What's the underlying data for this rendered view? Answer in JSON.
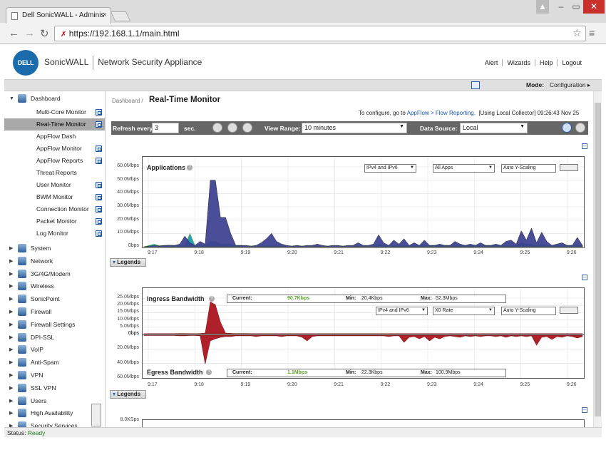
{
  "browser": {
    "tab_title": "Dell SonicWALL - Adminis",
    "url": "https://192.168.1.1/main.html"
  },
  "header": {
    "logo_text": "DELL",
    "product": "SonicWALL",
    "subtitle": "Network Security Appliance",
    "links": [
      "Alert",
      "Wizards",
      "Help",
      "Logout"
    ]
  },
  "modebar": {
    "label": "Mode:",
    "value": "Configuration"
  },
  "sidebar": {
    "dashboard_label": "Dashboard",
    "dashboard_items": [
      "Multi-Core Monitor",
      "Real-Time Monitor",
      "AppFlow Dash",
      "AppFlow Monitor",
      "AppFlow Reports",
      "Threat Reports",
      "User Monitor",
      "BWM Monitor",
      "Connection Monitor",
      "Packet Monitor",
      "Log Monitor"
    ],
    "dashboard_items_config": [
      true,
      true,
      false,
      true,
      true,
      false,
      true,
      true,
      true,
      true,
      true
    ],
    "selected_index": 1,
    "sections": [
      "System",
      "Network",
      "3G/4G/Modem",
      "Wireless",
      "SonicPoint",
      "Firewall",
      "Firewall Settings",
      "DPI-SSL",
      "VoIP",
      "Anti-Spam",
      "VPN",
      "SSL VPN",
      "Users",
      "High Availability",
      "Security Services"
    ]
  },
  "page": {
    "breadcrumb": "Dashboard /",
    "title": "Real-Time Monitor",
    "info_prefix": "To configure, go to",
    "info_link": "AppFlow > Flow Reporting.",
    "info_suffix": "[Using Local Collector] 09:26:43 Nov 25"
  },
  "toolbar": {
    "refresh_label": "Refresh every:",
    "refresh_value": "3",
    "refresh_unit": "sec.",
    "view_range_label": "View Range:",
    "view_range_value": "10 minutes",
    "data_source_label": "Data Source:",
    "data_source_value": "Local"
  },
  "chart_applications": {
    "type": "area",
    "title": "Applications",
    "y_ticks": [
      "60.0Mbps",
      "50.0Mbps",
      "40.0Mbps",
      "30.0Mbps",
      "20.0Mbps",
      "10.0Mbps",
      "0bps"
    ],
    "x_ticks": [
      "9:17",
      "9:18",
      "9:19",
      "9:20",
      "9:21",
      "9:22",
      "9:23",
      "9:24",
      "9:25",
      "9:26"
    ],
    "ip_filter": "IPv4 and IPv6",
    "app_filter": "All Apps",
    "scaling": "Auto Y-Scaling",
    "ylim_mbps": [
      0,
      60
    ],
    "series_main_mbps": [
      0,
      0.5,
      0.8,
      0.6,
      1,
      1.2,
      1,
      2,
      8,
      3,
      1,
      4,
      2,
      50,
      50,
      22,
      22,
      10,
      1,
      1,
      1,
      0.5,
      1,
      3,
      6,
      10,
      4,
      2,
      1,
      0.5,
      1,
      0.5,
      1,
      1,
      2,
      1,
      0.5,
      1,
      1,
      0.5,
      1,
      1,
      3,
      1,
      1,
      2,
      9,
      3,
      1,
      5,
      2,
      6,
      1,
      3,
      1,
      5,
      1,
      1,
      2,
      1,
      1,
      4,
      2,
      1,
      2,
      1,
      3,
      1,
      1,
      2,
      1,
      4,
      5,
      2,
      12,
      5,
      14,
      3,
      11,
      4,
      1,
      2,
      3,
      1,
      1,
      7,
      1
    ],
    "series_other_mbps": [
      0,
      1,
      2,
      0.8,
      1,
      0.6,
      1,
      1,
      1,
      10,
      1,
      1,
      1,
      4,
      4,
      2,
      2,
      2,
      1,
      1,
      0.5,
      0.5,
      0.5,
      0.5,
      1,
      1,
      1,
      0.5,
      0.5,
      0.5,
      0.5,
      0.5,
      0.5,
      0.5,
      0.5,
      0.5,
      0.5,
      0.5,
      0.5,
      0.5,
      0.5,
      0.5,
      0.5,
      0.5,
      0.5,
      0.5,
      2,
      1,
      1,
      1,
      1,
      1,
      1,
      1,
      1,
      1,
      1,
      1,
      1,
      1,
      1,
      1,
      1,
      1,
      1,
      1,
      1,
      1,
      1,
      1,
      1,
      1,
      1,
      1,
      3,
      2,
      2,
      1,
      2,
      1,
      1,
      1,
      1,
      1,
      1,
      1,
      1
    ]
  },
  "chart_bandwidth": {
    "type": "area",
    "ingress_title": "Ingress Bandwidth",
    "egress_title": "Egress Bandwidth",
    "ingress_y_ticks": [
      "25.0Mbps",
      "20.0Mbps",
      "15.0Mbps",
      "10.0Mbps",
      "5.0Mbps",
      "0bps"
    ],
    "egress_y_ticks": [
      "0bps",
      "20.0Mbps",
      "40.0Mbps",
      "60.0Mbps"
    ],
    "x_ticks": [
      "9:17",
      "9:18",
      "9:19",
      "9:20",
      "9:21",
      "9:22",
      "9:23",
      "9:24",
      "9:25",
      "9:26"
    ],
    "ingress_stats": {
      "current_label": "Current:",
      "current": "90.7Kbps",
      "min_label": "Min:",
      "min": "20.4Kbps",
      "max_label": "Max:",
      "max": "52.3Mbps"
    },
    "egress_stats": {
      "current_label": "Current:",
      "current": "1.1Mbps",
      "min_label": "Min:",
      "min": "22.3Kbps",
      "max_label": "Max:",
      "max": "100.9Mbps"
    },
    "ip_filter": "IPv4 and IPv6",
    "rate_filter": "X0 Rate",
    "scaling": "Auto Y-Scaling",
    "ingress_ylim_mbps": [
      0,
      25
    ],
    "egress_ylim_mbps": [
      0,
      60
    ],
    "ingress_mbps": [
      0,
      0.1,
      0.1,
      0.1,
      0.1,
      0.1,
      0.1,
      0.2,
      0.2,
      0.1,
      0.1,
      0.2,
      0.5,
      22,
      20,
      8,
      0.5,
      0.3,
      0.2,
      0.2,
      0.2,
      0.1,
      0.1,
      0.1,
      0.1,
      0.1,
      0.1,
      0.1,
      0.1,
      0.1,
      0.1,
      0.1,
      0.1,
      0.1,
      0.1,
      0.1,
      0.1,
      0.1,
      0.1,
      0.1,
      0.1,
      0.1,
      0.1,
      0.1,
      0.1,
      0.1,
      0.1,
      0.1,
      0.1,
      0.1,
      0.1,
      0.1,
      0.1,
      0.1,
      0.1,
      0.1,
      0.1,
      0.1,
      0.1,
      0.1,
      0.1,
      0.1,
      0.1,
      0.1,
      0.1,
      0.1,
      0.1,
      0.1,
      0.1,
      0.1,
      0.1,
      0.1,
      0.1,
      0.1,
      0.1,
      0.1,
      0.1,
      0.1,
      0.1,
      0.1,
      0.1,
      0.1,
      0.1,
      0.1,
      0.1,
      0.1,
      0.1
    ],
    "egress_mbps": [
      0.5,
      0.5,
      0.5,
      0.5,
      0.5,
      0.5,
      0.5,
      1,
      1,
      0.5,
      0.5,
      1,
      40,
      8,
      5,
      3,
      2,
      2,
      1,
      1,
      1,
      1,
      2,
      1,
      1,
      1,
      1,
      2,
      1,
      1,
      1,
      3,
      8,
      2,
      1,
      1,
      1,
      1,
      1,
      1,
      1,
      1,
      1,
      1,
      1,
      1,
      1,
      1,
      2,
      1,
      1,
      10,
      3,
      2,
      5,
      2,
      8,
      3,
      5,
      2,
      1,
      2,
      3,
      1,
      2,
      1,
      2,
      1,
      1,
      2,
      1,
      3,
      1,
      2,
      1,
      2,
      1,
      14,
      3,
      2,
      6,
      2,
      3,
      1,
      2,
      4,
      2
    ]
  },
  "legends_label": "Legends",
  "chart3_y_top": "8.0KSps",
  "status": {
    "label": "Status:",
    "value": "Ready"
  }
}
